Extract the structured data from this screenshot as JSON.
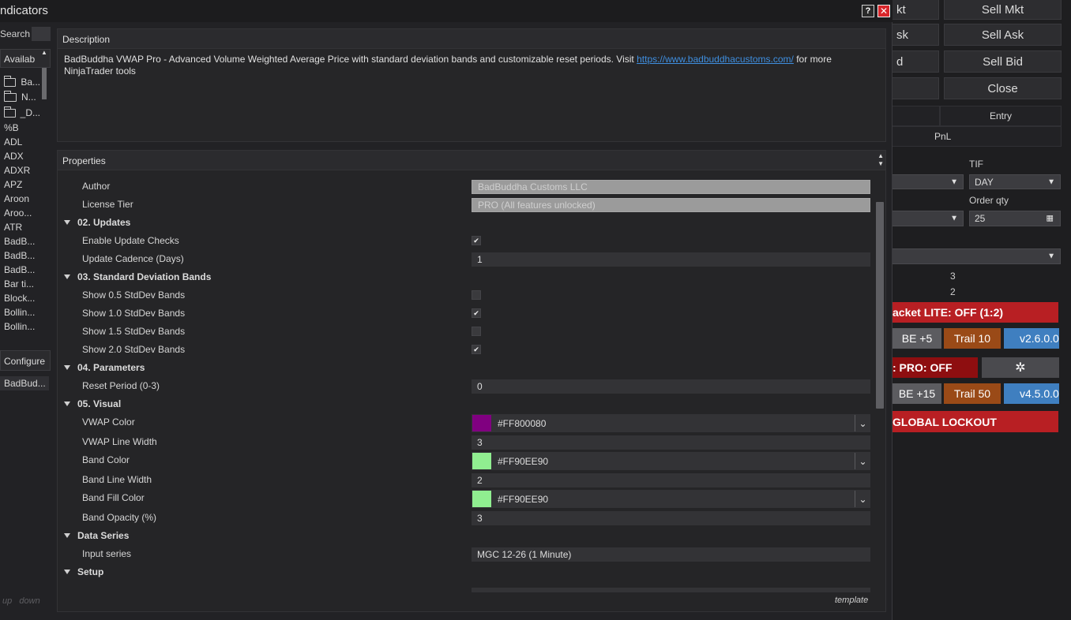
{
  "window": {
    "title": "ndicators",
    "help_label": "?",
    "close_label": "✕"
  },
  "left": {
    "search_label": "Search",
    "available_label": "Availab",
    "folders": [
      "Ba...",
      "N...",
      "_D..."
    ],
    "items": [
      "%B",
      "ADL",
      "ADX",
      "ADXR",
      "APZ",
      "Aroon",
      "Aroo...",
      "ATR",
      "BadB...",
      "BadB...",
      "BadB...",
      "Bar ti...",
      "Block...",
      "Bollin...",
      "Bollin..."
    ],
    "configure_label": "Configure",
    "configured_item": "BadBud...",
    "up_label": "up",
    "down_label": "down"
  },
  "description": {
    "header": "Description",
    "text_before": "BadBuddha VWAP Pro - Advanced Volume Weighted Average Price with standard deviation bands and customizable reset periods. Visit ",
    "link": "https://www.badbuddhacustoms.com/",
    "text_after": " for more NinjaTrader tools"
  },
  "properties": {
    "header": "Properties",
    "rows": [
      {
        "type": "text",
        "label": "Author",
        "value": "BadBuddha Customs LLC",
        "readonly": true
      },
      {
        "type": "text",
        "label": "License Tier",
        "value": "PRO (All features unlocked)",
        "readonly": true
      },
      {
        "type": "category",
        "label": "02. Updates"
      },
      {
        "type": "check",
        "label": "Enable Update Checks",
        "checked": true
      },
      {
        "type": "text",
        "label": "Update Cadence (Days)",
        "value": "1"
      },
      {
        "type": "category",
        "label": "03. Standard Deviation Bands"
      },
      {
        "type": "check",
        "label": "Show 0.5 StdDev Bands",
        "checked": false
      },
      {
        "type": "check",
        "label": "Show 1.0 StdDev Bands",
        "checked": true
      },
      {
        "type": "check",
        "label": "Show 1.5 StdDev Bands",
        "checked": false
      },
      {
        "type": "check",
        "label": "Show 2.0 StdDev Bands",
        "checked": true
      },
      {
        "type": "category",
        "label": "04. Parameters"
      },
      {
        "type": "text",
        "label": "Reset Period (0-3)",
        "value": "0"
      },
      {
        "type": "category",
        "label": "05. Visual"
      },
      {
        "type": "color",
        "label": "VWAP Color",
        "value": "#FF800080",
        "swatch": "#800080"
      },
      {
        "type": "text",
        "label": "VWAP Line Width",
        "value": "3"
      },
      {
        "type": "color",
        "label": "Band Color",
        "value": "#FF90EE90",
        "swatch": "#90EE90"
      },
      {
        "type": "text",
        "label": "Band Line Width",
        "value": "2"
      },
      {
        "type": "color",
        "label": "Band Fill Color",
        "value": "#FF90EE90",
        "swatch": "#90EE90"
      },
      {
        "type": "text",
        "label": "Band Opacity (%)",
        "value": "3"
      },
      {
        "type": "category",
        "label": "Data Series"
      },
      {
        "type": "text",
        "label": "Input series",
        "value": "MGC 12-26 (1 Minute)"
      },
      {
        "type": "category",
        "label": "Setup"
      }
    ],
    "template_label": "template"
  },
  "background_panel": {
    "buttons": {
      "buy_mkt_partial": "kt",
      "sell_mkt": "Sell Mkt",
      "buy_ask_partial": "sk",
      "sell_ask": "Sell Ask",
      "buy_bid_partial": "d",
      "sell_bid": "Sell Bid",
      "close": "Close"
    },
    "entry_label": "Entry",
    "pnl_label": "PnL",
    "tif_label": "TIF",
    "tif_value": "DAY",
    "order_qty_label": "Order qty",
    "order_qty_value": "25",
    "num_a": "3",
    "num_b": "2",
    "bracket_lite": "acket LITE: OFF (1:2)",
    "be5": "BE +5",
    "trail10": "Trail 10",
    "ver1": "v2.6.0.0",
    "pro_off": ": PRO: OFF",
    "gear": "✲",
    "be15": "BE +15",
    "trail50": "Trail 50",
    "ver2": "v4.5.0.0",
    "global_lockout": "GLOBAL LOCKOUT",
    "colors": {
      "red": "#b81f23",
      "dark_red": "#8e0e10",
      "orange": "#9a4a17",
      "blue": "#3f7fc0",
      "gray": "#5c5c60"
    }
  }
}
